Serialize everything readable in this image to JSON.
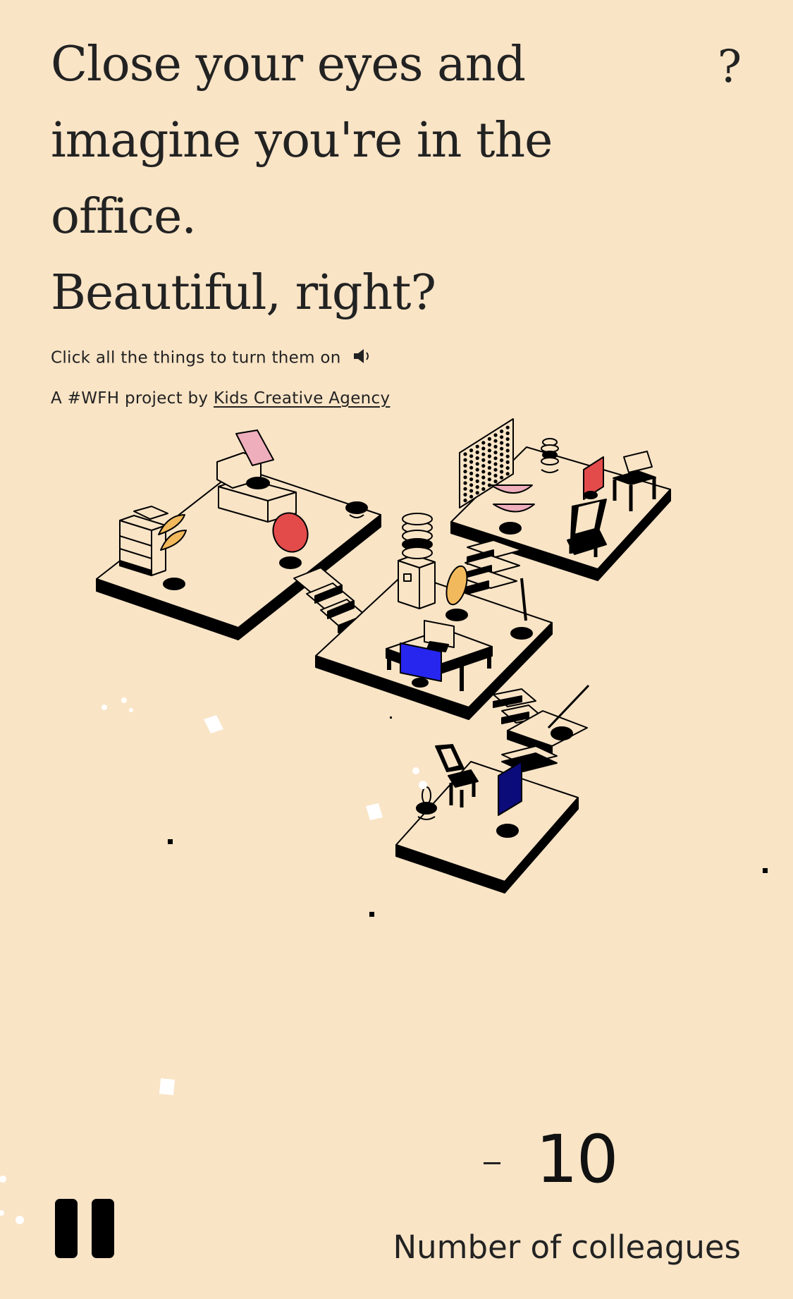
{
  "headline": {
    "lines": [
      "Close your eyes and",
      "imagine you're in the",
      "office.",
      "Beautiful, right?"
    ]
  },
  "help_button": {
    "label": "?"
  },
  "instruction": {
    "text": "Click all the things to turn them on",
    "icon": "speaker-icon"
  },
  "credit": {
    "prefix": "A #WFH project by ",
    "link_text": "Kids Creative Agency"
  },
  "colleagues": {
    "decrement_label": "-",
    "count": "10",
    "label": "Number of colleagues"
  },
  "controls": {
    "pause_icon": "pause-icon"
  },
  "colors": {
    "background": "#f9e4c6",
    "ink": "#000000",
    "red": "#e34b4b",
    "pink": "#eeaebb",
    "yellow": "#f2b95c",
    "blue": "#2626ee",
    "navy": "#0b0b7a"
  }
}
